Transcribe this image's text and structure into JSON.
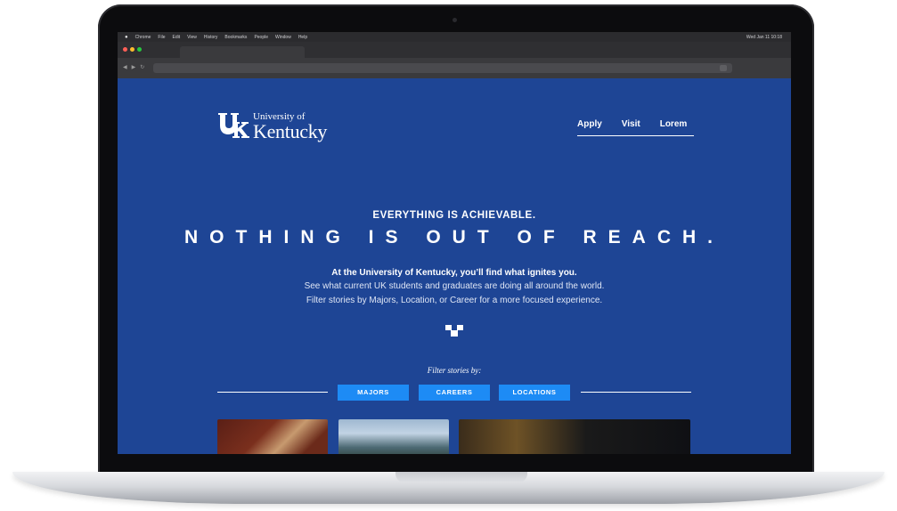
{
  "browser": {
    "menu_items": [
      "Chrome",
      "File",
      "Edit",
      "View",
      "History",
      "Bookmarks",
      "People",
      "Window",
      "Help"
    ],
    "status_right": "Wed Jan 11 10:18"
  },
  "site": {
    "logo_line1": "University of",
    "logo_line2": "Kentucky",
    "nav": [
      "Apply",
      "Visit",
      "Lorem"
    ]
  },
  "hero": {
    "kicker": "EVERYTHING IS ACHIEVABLE.",
    "headline": "NOTHING IS OUT OF REACH.",
    "lead": "At the University of Kentucky, you’ll find what ignites you.",
    "body_line1": "See what current UK students and graduates are doing all around the world.",
    "body_line2": "Filter stories by Majors, Location, or Career for a more focused experience."
  },
  "filter": {
    "label": "Filter stories by:",
    "buttons": [
      "MAJORS",
      "CAREERS",
      "LOCATIONS"
    ]
  },
  "colors": {
    "page_bg": "#1e4595",
    "button_bg": "#1d8bf5",
    "text": "#ffffff"
  }
}
